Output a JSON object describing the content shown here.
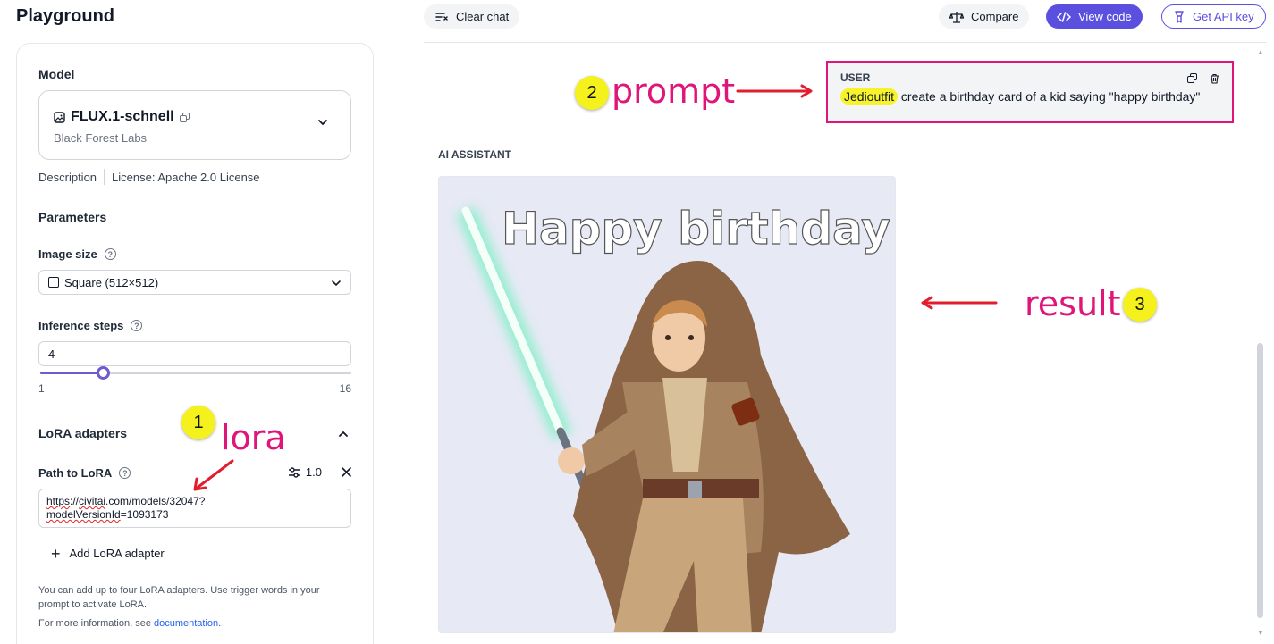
{
  "header": {
    "title": "Playground"
  },
  "toolbar": {
    "clear_chat": "Clear chat",
    "compare": "Compare",
    "view_code": "View code",
    "get_api_key": "Get API key"
  },
  "sidebar": {
    "model_heading": "Model",
    "model_name": "FLUX.1-schnell",
    "model_org": "Black Forest Labs",
    "description_link": "Description",
    "license": "License: Apache 2.0 License",
    "parameters_heading": "Parameters",
    "image_size_label": "Image size",
    "image_size_value": "Square (512×512)",
    "inference_steps_label": "Inference steps",
    "inference_steps_value": "4",
    "inference_steps_fraction": 0.2,
    "slider_min": "1",
    "slider_max": "16",
    "lora_heading": "LoRA adapters",
    "path_to_lora_label": "Path to LoRA",
    "lora_strength": "1.0",
    "lora_url_line1_a": "https",
    "lora_url_line1_b": "://",
    "lora_url_line1_c": "civitai",
    "lora_url_line1_d": ".com/models/32047?",
    "lora_url_line2_a": "modelVersionId",
    "lora_url_line2_b": "=1093173",
    "add_lora": "Add LoRA adapter",
    "help_text": "You can add up to four LoRA adapters. Use trigger words in your prompt to activate LoRA.",
    "info_prefix": "For more information, see ",
    "info_link": "documentation",
    "info_suffix": "."
  },
  "chat": {
    "user_label": "USER",
    "trigger_word": "Jedioutfit",
    "user_message": " create a birthday card of a kid saying \"happy birthday\"",
    "assistant_label": "AI ASSISTANT",
    "image_text": "Happy birthday"
  },
  "annotations": {
    "badge1": "1",
    "label1": "lora",
    "badge2": "2",
    "label2": "prompt",
    "badge3": "3",
    "label3": "result",
    "color": "#e0157a",
    "badge_color": "#f5f11d"
  },
  "colors": {
    "accent": "#5b4fe0",
    "slider": "#6d5bd0"
  }
}
